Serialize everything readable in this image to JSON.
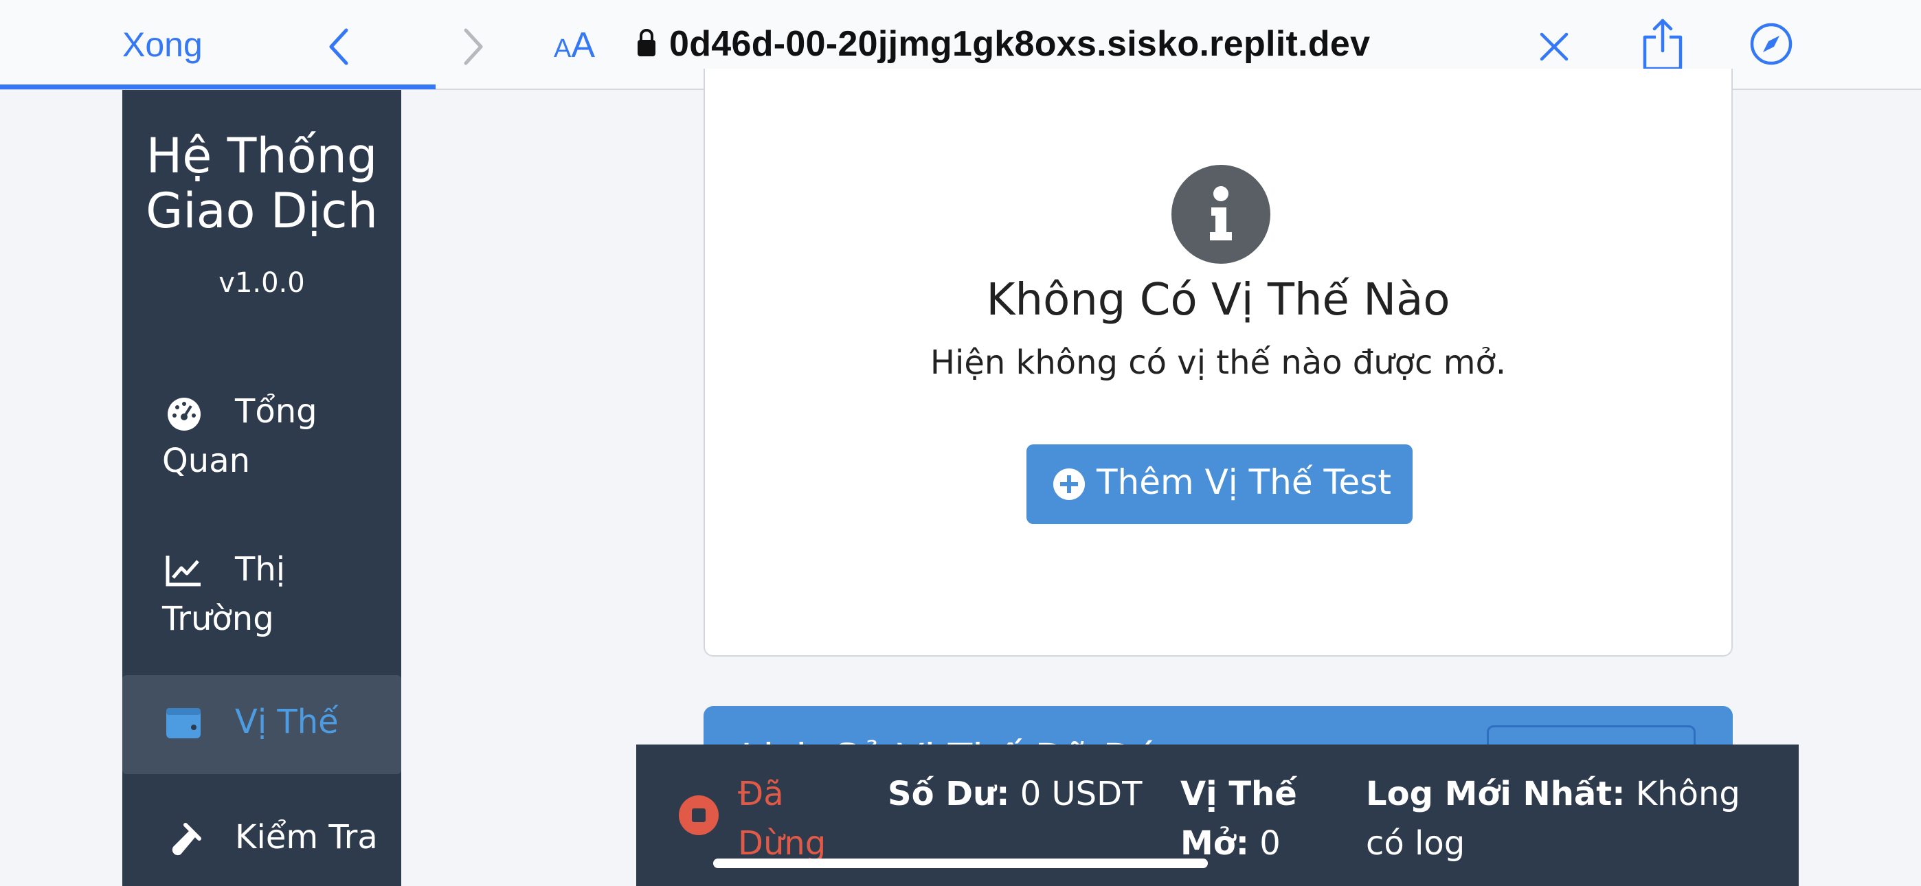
{
  "browser": {
    "done_label": "Xong",
    "text_size_small": "A",
    "text_size_large": "A",
    "url": "0d46d-00-20jjmg1gk8oxs.sisko.replit.dev",
    "accent_color": "#3478f6",
    "icons": [
      "back-icon",
      "forward-icon",
      "lock-icon",
      "close-icon",
      "share-icon",
      "compass-icon"
    ]
  },
  "sidebar": {
    "title_line1": "Hệ Thống",
    "title_line2": "Giao Dịch",
    "version": "v1.0.0",
    "items": [
      {
        "label": "Tổng Quan",
        "icon": "dashboard-icon",
        "active": false
      },
      {
        "label": "Thị Trường",
        "icon": "chart-line-icon",
        "active": false
      },
      {
        "label": "Vị Thế",
        "icon": "wallet-icon",
        "active": true
      },
      {
        "label": "Kiểm Tra",
        "icon": "vial-icon",
        "active": false
      }
    ]
  },
  "main": {
    "empty_title": "Không Có Vị Thế Nào",
    "empty_text": "Hiện không có vị thế nào được mở.",
    "add_button_label": "Thêm Vị Thế Test",
    "history_title": "Lịch Sử Vị Thế Đã Đóng"
  },
  "status": {
    "state": "Đã Dừng",
    "balance_label": "Số Dư:",
    "balance_value": "0 USDT",
    "open_positions_label": "Vị Thế Mở:",
    "open_positions_value": "0",
    "latest_log_label": "Log Mới Nhất:",
    "latest_log_value": "Không có log",
    "stopped_color": "#e05a47"
  }
}
